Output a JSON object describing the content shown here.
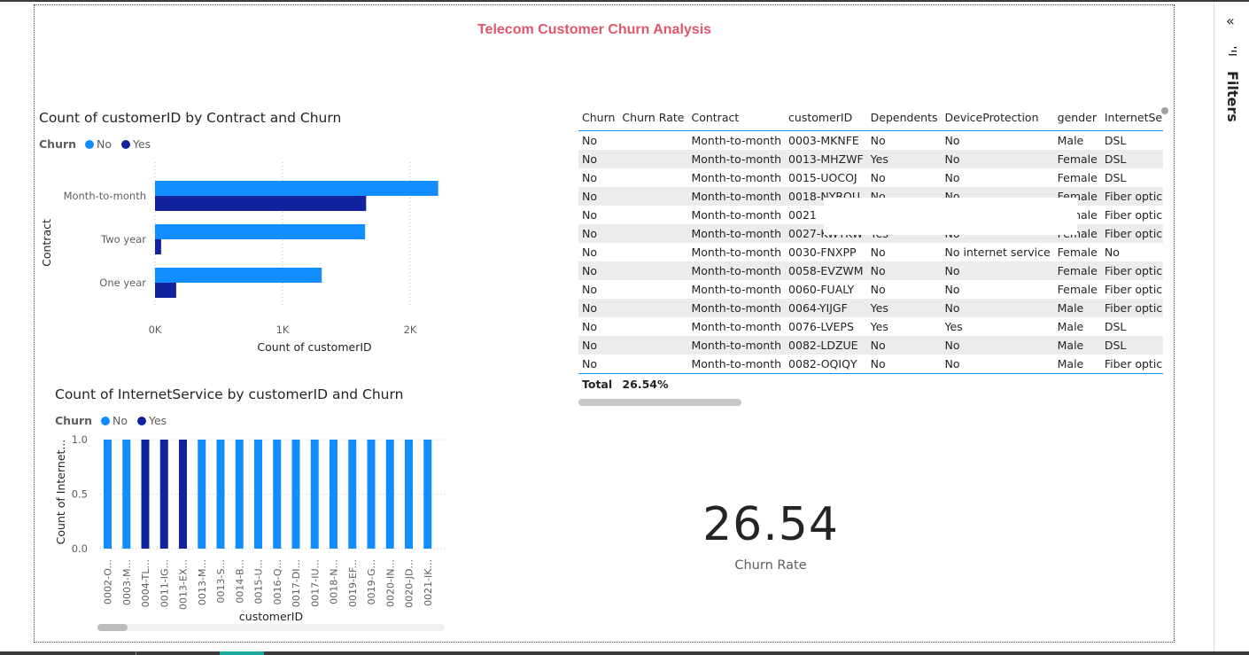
{
  "report": {
    "title": "Telecom Customer Churn Analysis"
  },
  "colors": {
    "no": "#118dff",
    "yes": "#12239e",
    "title": "#e0566c"
  },
  "chart1": {
    "title": "Count of customerID by Contract and Churn",
    "legend_title": "Churn",
    "legend": [
      "No",
      "Yes"
    ]
  },
  "chart2": {
    "title": "Count of InternetService by customerID and Churn",
    "legend_title": "Churn",
    "legend": [
      "No",
      "Yes"
    ]
  },
  "chart_data": [
    {
      "type": "bar",
      "orientation": "horizontal",
      "title": "Count of customerID by Contract and Churn",
      "xlabel": "Count of customerID",
      "ylabel": "Contract",
      "categories": [
        "Month-to-month",
        "Two year",
        "One year"
      ],
      "series": [
        {
          "name": "No",
          "values": [
            2220,
            1647,
            1307
          ]
        },
        {
          "name": "Yes",
          "values": [
            1655,
            48,
            166
          ]
        }
      ],
      "xlim": [
        0,
        2300
      ],
      "xticks": [
        0,
        1000,
        2000
      ],
      "xtick_labels": [
        "0K",
        "1K",
        "2K"
      ],
      "grid": true,
      "legend_position": "top-left"
    },
    {
      "type": "bar",
      "orientation": "vertical",
      "title": "Count of InternetService by customerID and Churn",
      "xlabel": "customerID",
      "ylabel": "Count of Internet...",
      "categories": [
        "0002-O...",
        "0003-M...",
        "0004-TL...",
        "0011-IG...",
        "0013-EX...",
        "0013-M...",
        "0013-S...",
        "0014-B...",
        "0015-U...",
        "0016-Q...",
        "0017-DI...",
        "0017-IU...",
        "0018-N...",
        "0019-EF...",
        "0019-G...",
        "0020-IN...",
        "0020-JD...",
        "0021-IK..."
      ],
      "series": [
        {
          "name": "No",
          "values": [
            1,
            1,
            0,
            0,
            0,
            1,
            1,
            1,
            1,
            1,
            1,
            1,
            1,
            1,
            1,
            1,
            1,
            1
          ]
        },
        {
          "name": "Yes",
          "values": [
            0,
            0,
            1,
            1,
            1,
            0,
            0,
            0,
            0,
            0,
            0,
            0,
            0,
            0,
            0,
            0,
            0,
            0
          ]
        }
      ],
      "ylim": [
        0,
        1
      ],
      "yticks": [
        0,
        0.5,
        1
      ],
      "ytick_labels": [
        "0.0",
        "0.5",
        "1.0"
      ],
      "grid": true,
      "legend_position": "top-left"
    }
  ],
  "table": {
    "columns": [
      "Churn",
      "Churn Rate",
      "Contract",
      "customerID",
      "Dependents",
      "DeviceProtection",
      "gender",
      "InternetSe"
    ],
    "rows": [
      [
        "No",
        "",
        "Month-to-month",
        "0003-MKNFE",
        "No",
        "No",
        "Male",
        "DSL"
      ],
      [
        "No",
        "",
        "Month-to-month",
        "0013-MHZWF",
        "Yes",
        "No",
        "Female",
        "DSL"
      ],
      [
        "No",
        "",
        "Month-to-month",
        "0015-UOCOJ",
        "No",
        "No",
        "Female",
        "DSL"
      ],
      [
        "No",
        "",
        "Month-to-month",
        "0018-NYROU",
        "No",
        "No",
        "Female",
        "Fiber optic"
      ],
      [
        "No",
        "",
        "Month-to-month",
        "0021",
        "",
        "",
        "Female",
        "Fiber optic"
      ],
      [
        "No",
        "",
        "Month-to-month",
        "0027-KWYKW",
        "Yes",
        "No",
        "Female",
        "Fiber optic"
      ],
      [
        "No",
        "",
        "Month-to-month",
        "0030-FNXPP",
        "No",
        "No internet service",
        "Female",
        "No"
      ],
      [
        "No",
        "",
        "Month-to-month",
        "0058-EVZWM",
        "No",
        "No",
        "Female",
        "Fiber optic"
      ],
      [
        "No",
        "",
        "Month-to-month",
        "0060-FUALY",
        "No",
        "No",
        "Female",
        "Fiber optic"
      ],
      [
        "No",
        "",
        "Month-to-month",
        "0064-YIJGF",
        "Yes",
        "No",
        "Male",
        "Fiber optic"
      ],
      [
        "No",
        "",
        "Month-to-month",
        "0076-LVEPS",
        "Yes",
        "Yes",
        "Male",
        "DSL"
      ],
      [
        "No",
        "",
        "Month-to-month",
        "0082-LDZUE",
        "No",
        "No",
        "Male",
        "DSL"
      ],
      [
        "No",
        "",
        "Month-to-month",
        "0082-OQIQY",
        "No",
        "No",
        "Male",
        "Fiber optic"
      ]
    ],
    "total_label": "Total",
    "total_value": "26.54%"
  },
  "card": {
    "value": "26.54",
    "label": "Churn Rate"
  },
  "filters": {
    "label": "Filters",
    "collapse_glyph": "«"
  }
}
